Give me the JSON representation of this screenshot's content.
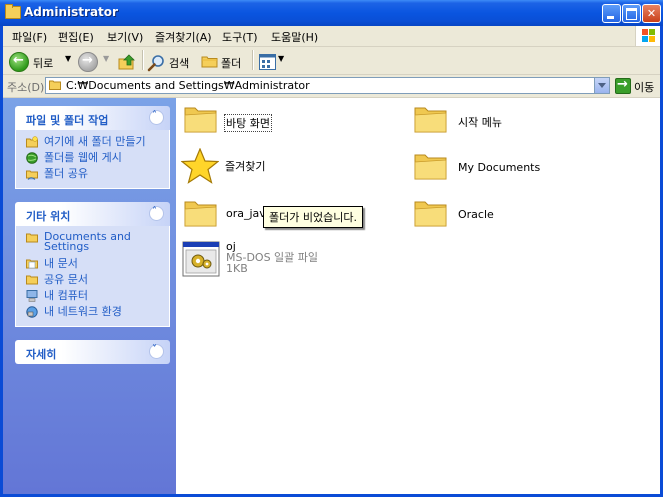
{
  "window": {
    "title": "Administrator"
  },
  "menubar": {
    "items": [
      "파일(F)",
      "편집(E)",
      "보기(V)",
      "즐겨찾기(A)",
      "도구(T)",
      "도움말(H)"
    ]
  },
  "toolbar": {
    "back_label": "뒤로",
    "search_label": "검색",
    "folders_label": "폴더"
  },
  "addressbar": {
    "label": "주소(D)",
    "path": "C:₩Documents and Settings₩Administrator",
    "go_label": "이동"
  },
  "taskpane": {
    "file_tasks": {
      "title": "파일 및 폴더 작업",
      "items": [
        "여기에 새 폴더 만들기",
        "폴더를 웹에 게시",
        "폴더 공유"
      ]
    },
    "other_places": {
      "title": "기타 위치",
      "items": [
        "Documents and Settings",
        "내 문서",
        "공유 문서",
        "내 컴퓨터",
        "내 네트워크 환경"
      ]
    },
    "details": {
      "title": "자세히"
    }
  },
  "content": {
    "items": [
      {
        "name": "바탕 화면",
        "icon": "folder-icon"
      },
      {
        "name": "시작 메뉴",
        "icon": "folder-icon"
      },
      {
        "name": "즐겨찾기",
        "icon": "star-icon"
      },
      {
        "name": "My Documents",
        "icon": "folder-icon"
      },
      {
        "name": "ora_java",
        "icon": "folder-icon"
      },
      {
        "name": "Oracle",
        "icon": "folder-icon"
      }
    ],
    "batch_file": {
      "name": "oj",
      "type": "MS-DOS 일괄 파일",
      "size": "1KB"
    },
    "tooltip": "폴더가 비었습니다."
  },
  "colors": {
    "titlebar": "#0a55e0",
    "taskpane_top": "#7ba2e7",
    "taskpane_bottom": "#6376d6",
    "link": "#215dc6",
    "tooltip_bg": "#ffffe1"
  }
}
